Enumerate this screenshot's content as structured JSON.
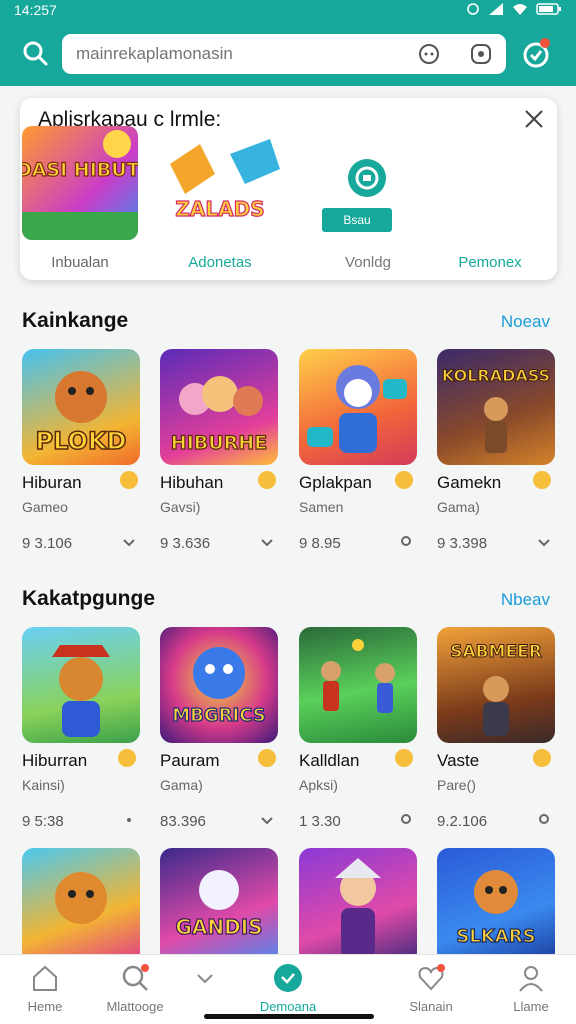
{
  "status": {
    "time": "14:257"
  },
  "search": {
    "placeholder": "mainrekaplamonasin"
  },
  "popup": {
    "title": "Aplisrkapau c lrmle:",
    "items": [
      {
        "label": "Inbualan",
        "art_text": "RADASI HIBUTEIS"
      },
      {
        "label": "Adonetas",
        "art_text": "ZALADS"
      },
      {
        "label": "Vonldg",
        "button": "Bsau"
      },
      {
        "label": "Pemonex"
      }
    ]
  },
  "sections": [
    {
      "title": "Kainkange",
      "more": "Noeav",
      "cards": [
        {
          "name": "Hiburan",
          "category": "Gameo",
          "downloads": "9 3.106",
          "art_text": "PLOKD"
        },
        {
          "name": "Hibuhan",
          "category": "Gavsi)",
          "downloads": "9 3.636",
          "art_text": "HIBURHE"
        },
        {
          "name": "Gplakpan",
          "category": "Samen",
          "downloads": "9 8.95",
          "art_text": ""
        },
        {
          "name": "Gamekn",
          "category": "Gama)",
          "downloads": "9 3.398",
          "art_text": "KOLRADASS"
        }
      ]
    },
    {
      "title": "Kakatpgunge",
      "more": "Nbeav",
      "cards": [
        {
          "name": "Hiburran",
          "category": "Kainsi)",
          "downloads": "9 5:38",
          "art_text": ""
        },
        {
          "name": "Pauram",
          "category": "Gama)",
          "downloads": "83.396",
          "art_text": "MBGRICS"
        },
        {
          "name": "Kalldlan",
          "category": "Apksi)",
          "downloads": "1 3.30",
          "art_text": ""
        },
        {
          "name": "Vaste",
          "category": "Pare()",
          "downloads": "9.2.106",
          "art_text": "SABMEER"
        }
      ]
    },
    {
      "cards": [
        {
          "art_text": ""
        },
        {
          "art_text": "GANDIS"
        },
        {
          "art_text": ""
        },
        {
          "art_text": "SLKARS"
        }
      ]
    }
  ],
  "nav": [
    {
      "label": "Heme"
    },
    {
      "label": "Mlattooge"
    },
    {
      "label": "Demoana"
    },
    {
      "label": "Slanain"
    },
    {
      "label": "Llame"
    }
  ],
  "colors": {
    "brand": "#16a89a",
    "link": "#1a9cd8",
    "badge": "#f6be3a",
    "alert": "#f1533c"
  }
}
